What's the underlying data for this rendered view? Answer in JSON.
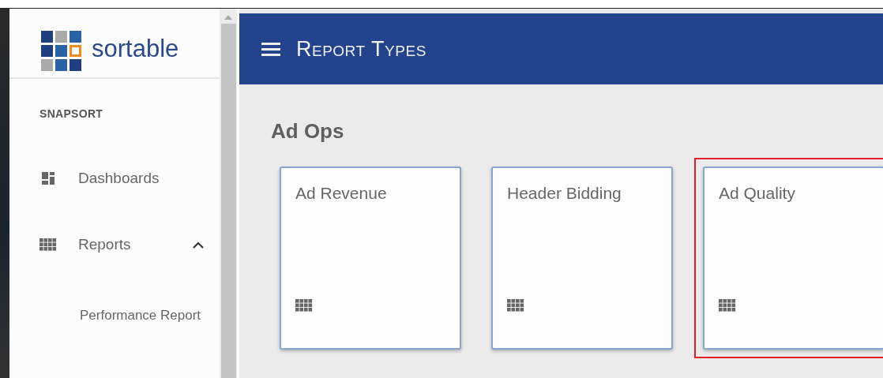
{
  "sidebar": {
    "logo_text": "sortable",
    "section_label": "SNAPSORT",
    "items": [
      {
        "label": "Dashboards"
      },
      {
        "label": "Reports",
        "expanded": true,
        "children": [
          {
            "label": "Performance Report"
          }
        ]
      }
    ]
  },
  "header": {
    "title": "Report Types"
  },
  "content": {
    "heading": "Ad Ops",
    "cards": [
      {
        "title": "Ad Revenue",
        "highlighted": false
      },
      {
        "title": "Header Bidding",
        "highlighted": false
      },
      {
        "title": "Ad Quality",
        "highlighted": true
      }
    ]
  }
}
